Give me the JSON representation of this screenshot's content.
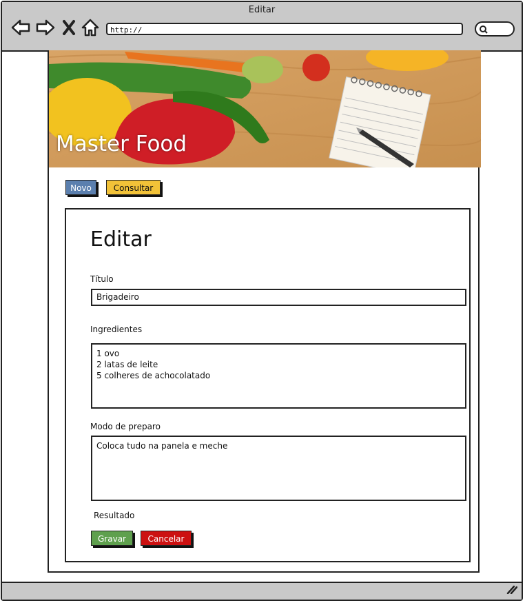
{
  "browser": {
    "window_title": "Editar",
    "url": "http://",
    "icons": [
      "back-arrow-icon",
      "forward-arrow-icon",
      "close-x-icon",
      "home-icon",
      "search-icon",
      "resize-grip-icon"
    ]
  },
  "banner": {
    "title": "Master Food"
  },
  "top_buttons": {
    "novo": "Novo",
    "consultar": "Consultar"
  },
  "form": {
    "heading": "Editar",
    "titulo_label": "Título",
    "titulo_value": "Brigadeiro",
    "ingredientes_label": "Ingredientes",
    "ingredientes_value": "1 ovo\n2 latas de leite\n5 colheres de achocolatado",
    "modo_label": "Modo de preparo",
    "modo_value": "Coloca tudo na panela e meche",
    "resultado_label": "Resultado",
    "gravar": "Gravar",
    "cancelar": "Cancelar"
  },
  "colors": {
    "novo_button": "#5b7fae",
    "consultar_button": "#f2c238",
    "gravar_button": "#5fa04e",
    "cancelar_button": "#cc1111",
    "chrome": "#c9c9c9"
  }
}
